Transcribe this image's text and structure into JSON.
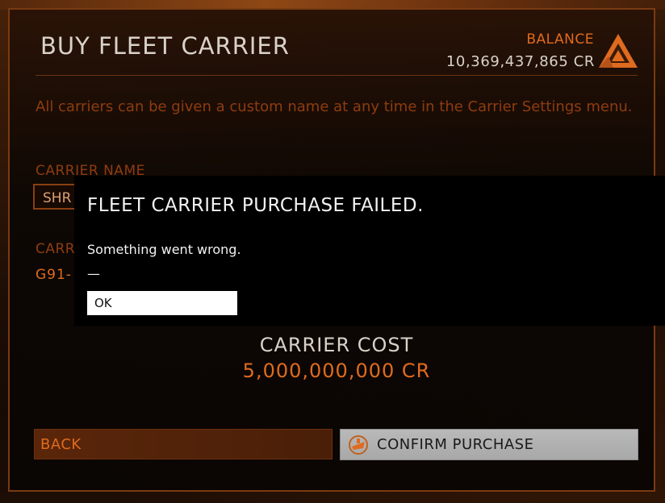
{
  "page": {
    "title": "BUY FLEET CARRIER",
    "balance_label": "BALANCE",
    "balance_value": "10,369,437,865 CR",
    "intro": "All carriers can be given a custom name at any time in the Carrier Settings menu.",
    "carrier_name_label": "CARRIER NAME",
    "carrier_name_value": "SHR",
    "callsign_label": "CARR",
    "callsign_value": "G91-",
    "cost_label": "CARRIER COST",
    "cost_value": "5,000,000,000 CR",
    "back_label": "BACK",
    "confirm_label": "CONFIRM PURCHASE",
    "footer_ghost": "BUY FLEET CARRIER"
  },
  "modal": {
    "title": "FLEET CARRIER PURCHASE FAILED.",
    "message": "Something went wrong.",
    "detail": "—",
    "ok_label": "OK"
  },
  "colors": {
    "accent": "#e06b1e",
    "text": "#d9d2c8",
    "muted": "#8e3c10",
    "modal_bg": "#000000"
  },
  "icons": {
    "logo": "elite-triangle-logo-icon",
    "confirm": "fleet-carrier-icon"
  }
}
